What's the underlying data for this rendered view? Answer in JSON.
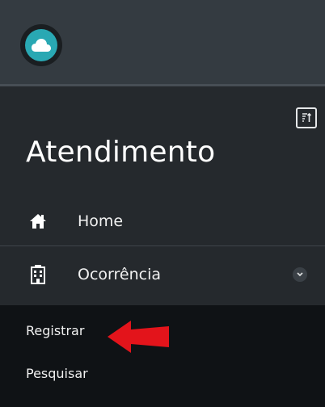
{
  "app": {
    "logo_icon": "cloud-icon",
    "accent_color": "#29a8b3",
    "arrow_color": "#e3141b"
  },
  "sidebar": {
    "title": "Atendimento",
    "collapse_icon": "sort-icon",
    "items": [
      {
        "label": "Home",
        "icon": "home-icon"
      },
      {
        "label": "Ocorrência",
        "icon": "building-icon",
        "expanded": true
      }
    ],
    "submenu": [
      {
        "label": "Registrar"
      },
      {
        "label": "Pesquisar"
      }
    ]
  }
}
